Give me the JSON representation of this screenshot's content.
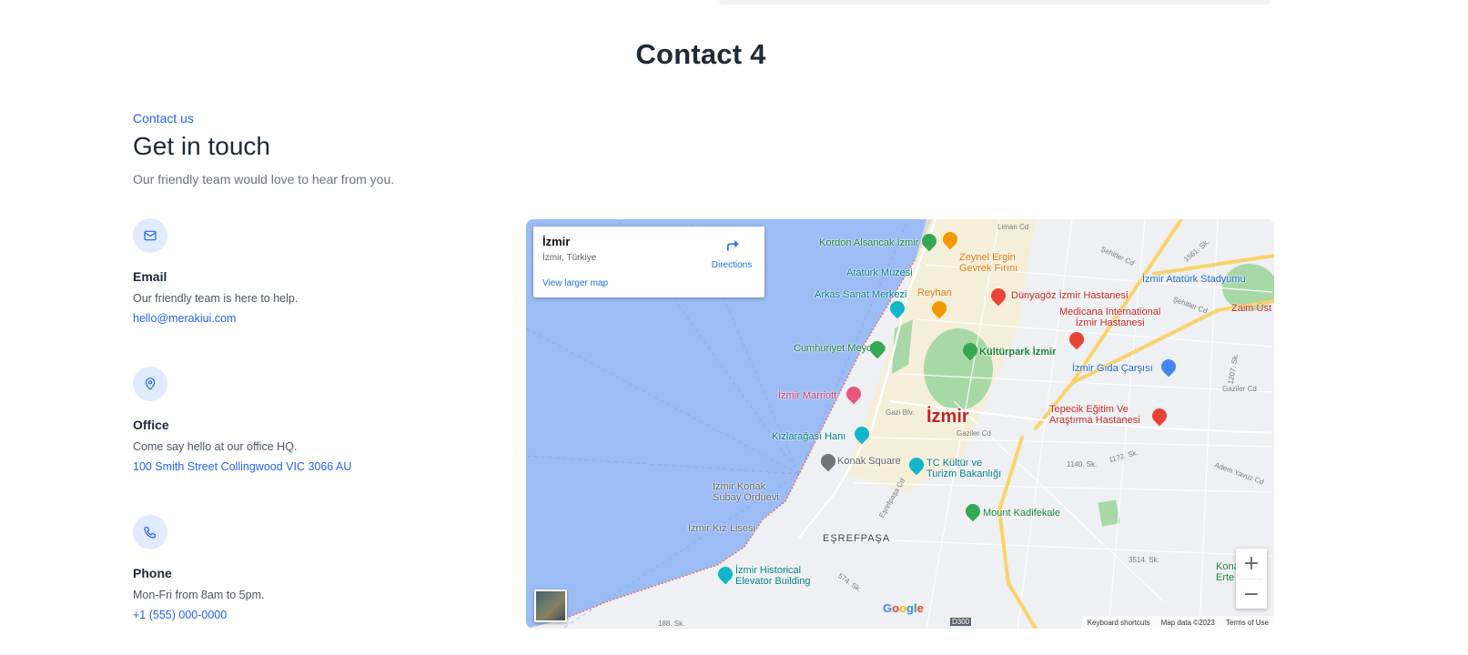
{
  "page": {
    "section_title": "Contact 4",
    "eyebrow": "Contact us",
    "heading": "Get in touch",
    "subheading": "Our friendly team would love to hear from you."
  },
  "contacts": [
    {
      "icon": "mail-icon",
      "label": "Email",
      "description": "Our friendly team is here to help.",
      "link": "hello@merakiui.com"
    },
    {
      "icon": "map-pin-icon",
      "label": "Office",
      "description": "Come say hello at our office HQ.",
      "link": "100 Smith Street Collingwood VIC 3066 AU"
    },
    {
      "icon": "phone-icon",
      "label": "Phone",
      "description": "Mon-Fri from 8am to 5pm.",
      "link": "+1 (555) 000-0000"
    }
  ],
  "map": {
    "place_name": "İzmir",
    "place_address": "İzmir, Türkiye",
    "directions_label": "Directions",
    "larger_map_label": "View larger map",
    "city_label": "İzmir",
    "places": {
      "kordon": "Kordon Alsancak İzmir",
      "zeynel": "Zeynel Ergin\nGevrek Fırını",
      "ataturk_muzesi": "Atatürk Müzesi",
      "arkas": "Arkas Sanat Merkezi",
      "reyhan": "Reyhan",
      "dunyagoz": "Dünyagöz İzmir Hastanesi",
      "medicana": "Medicana International\nİzmir Hastanesi",
      "stadyum": "İzmir Atatürk Stadyumu",
      "zaim": "Zaim Üst",
      "cumhuriyet": "Cumhuriyet Meydanı",
      "kulturpark": "Kültürpark İzmir",
      "gida": "İzmir Gıda Çarşısı",
      "marriott": "İzmir Marriott",
      "tepecik": "Tepecik Eğitim Ve\nAraştırma Hastanesi",
      "kizlaragasi": "Kızlarağası Hanı",
      "konak_square": "Konak Square",
      "tc_kultur": "TC Kültür ve\nTurizm Bakanlığı",
      "konak_subay": "İzmir Konak\nSubay Orduevi",
      "kiz_lisesi": "İzmir Kız Lisesi",
      "kadifekale": "Mount Kadifekale",
      "esrefpasa": "EŞREFPAŞA",
      "elevator": "İzmir Historical\nElevator Building",
      "konak_right": "Kona\nErte"
    },
    "roads": {
      "liman": "Liman Cd",
      "sehitler1": "Şehitler Cd",
      "sehitler2": "Şehitler Cd",
      "gazi_blv": "Gazi Blv.",
      "gaziler": "Gaziler Cd",
      "gaziler2": "Gaziler Cd",
      "esrefpasa_cd": "Eşrefpaşa Cd",
      "sk1140": "1140. Sk.",
      "sk1172": "1172. Sk.",
      "sk3514": "3514. Sk.",
      "sk574": "574. Sk.",
      "sk188": "188. Sk.",
      "sk1561": "1561. Sk.",
      "sk1207": "1207. Sk.",
      "adem": "Adem Yavuz Cd",
      "d300": "D300"
    },
    "zoom_in": "+",
    "zoom_out": "−",
    "google_letters": [
      "G",
      "o",
      "o",
      "g",
      "l",
      "e"
    ],
    "attribution": {
      "shortcuts": "Keyboard shortcuts",
      "data": "Map data ©2023",
      "terms": "Terms of Use"
    }
  },
  "colors": {
    "accent": "#2563eb",
    "icon_bg": "#e0ebfd",
    "heading": "#1f2937",
    "muted": "#6b7280",
    "sea": "#9cbcf5",
    "park": "#a8d8a6",
    "road_major": "#f9d36a"
  }
}
